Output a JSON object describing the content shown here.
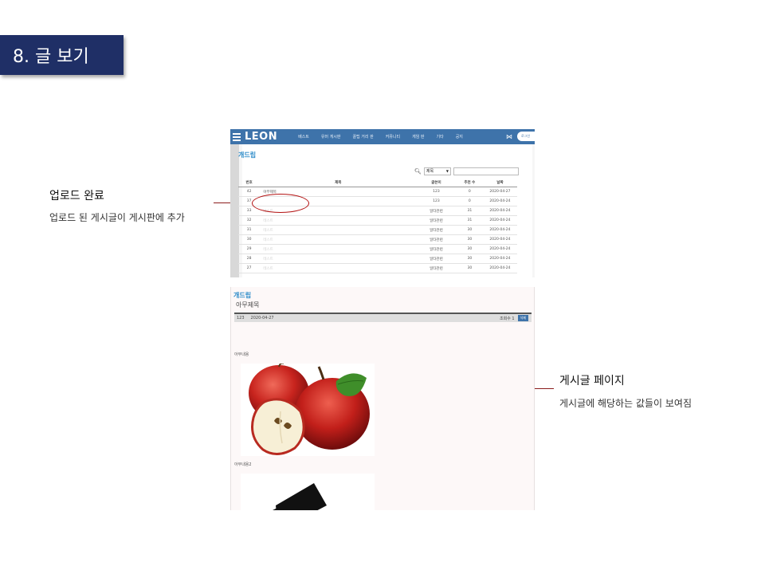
{
  "slide": {
    "title": "8. 글 보기"
  },
  "callouts": {
    "upload": {
      "title": "업로드 완료",
      "description": "업로드 된 게시글이 게시판에 추가"
    },
    "post_page": {
      "title": "게시글 페이지",
      "description": "게시글에 해당하는 값들이 보여짐"
    }
  },
  "board_screenshot": {
    "logo": "LEON",
    "menu": [
      "베스트",
      "유머 게시판",
      "꿀팁 거리 판",
      "커뮤니티",
      "게임 판",
      "기타",
      "공지"
    ],
    "login_label": "로그인",
    "board_title": "개드립",
    "search": {
      "selected_field": "제목",
      "value": ""
    },
    "table": {
      "columns": [
        "번호",
        "제목",
        "글쓴이",
        "추천 수",
        "날짜"
      ],
      "rows": [
        {
          "no": "42",
          "title": "아무제목",
          "author": "123",
          "rec": "0",
          "date": "2020-04-27"
        },
        {
          "no": "37",
          "title": "",
          "author": "123",
          "rec": "0",
          "date": "2020-04-24"
        },
        {
          "no": "33",
          "title": "테스트",
          "author": "일타관련",
          "rec": "31",
          "date": "2020-04-24"
        },
        {
          "no": "32",
          "title": "테스트",
          "author": "일타관련",
          "rec": "31",
          "date": "2020-04-24"
        },
        {
          "no": "31",
          "title": "테스트",
          "author": "일타관련",
          "rec": "30",
          "date": "2020-04-24"
        },
        {
          "no": "30",
          "title": "테스트",
          "author": "일타관련",
          "rec": "30",
          "date": "2020-04-24"
        },
        {
          "no": "29",
          "title": "테스트",
          "author": "일타관련",
          "rec": "30",
          "date": "2020-04-24"
        },
        {
          "no": "28",
          "title": "테스트",
          "author": "일타관련",
          "rec": "30",
          "date": "2020-04-24"
        },
        {
          "no": "27",
          "title": "테스트",
          "author": "일타관련",
          "rec": "30",
          "date": "2020-04-24"
        }
      ]
    }
  },
  "post_screenshot": {
    "board_title": "개드립",
    "post_title": "아무제목",
    "author": "123",
    "date": "2020-04-27",
    "views": "조회수 1",
    "delete_label": "삭제",
    "body_text_1": "아무내용",
    "body_text_2": "아무내용2"
  },
  "colors": {
    "title_box": "#1f2f66",
    "nav_bar": "#3e73aa",
    "highlight": "#b31212",
    "accent_title": "#2a8ac8"
  }
}
